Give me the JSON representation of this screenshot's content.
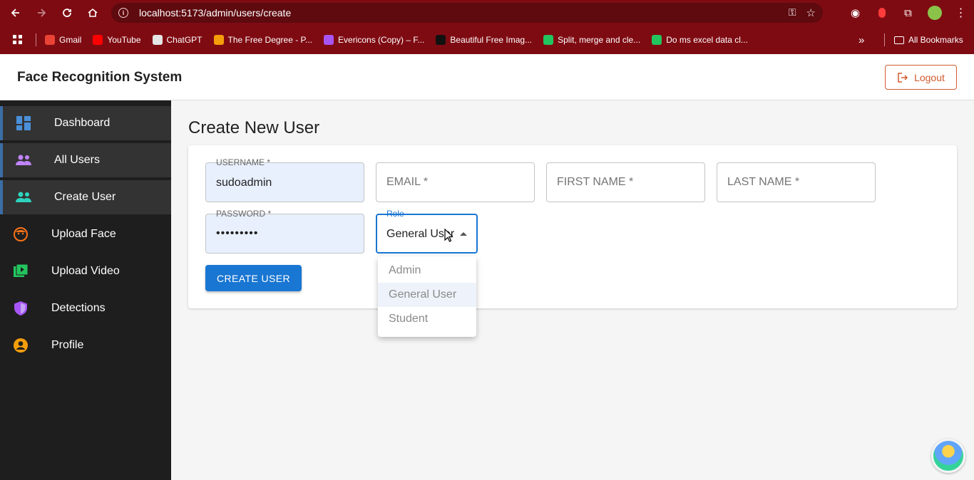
{
  "browser": {
    "url": "localhost:5173/admin/users/create",
    "bookmarks": [
      {
        "label": "Gmail",
        "color": "#ea4335"
      },
      {
        "label": "YouTube",
        "color": "#ff0000"
      },
      {
        "label": "ChatGPT",
        "color": "#e5e5e5"
      },
      {
        "label": "The Free Degree - P...",
        "color": "#f59e0b"
      },
      {
        "label": "Evericons (Copy) – F...",
        "color": "#a855f7"
      },
      {
        "label": "Beautiful Free Imag...",
        "color": "#111111"
      },
      {
        "label": "Split, merge and cle...",
        "color": "#22c55e"
      },
      {
        "label": "Do ms excel data cl...",
        "color": "#22c55e"
      }
    ],
    "all_bookmarks_label": "All Bookmarks"
  },
  "header": {
    "title": "Face Recognition System",
    "logout_label": "Logout"
  },
  "sidebar": {
    "items": [
      {
        "label": "Dashboard",
        "icon": "dashboard-icon",
        "color": "#4a90d9"
      },
      {
        "label": "All Users",
        "icon": "users-icon",
        "color": "#c084fc"
      },
      {
        "label": "Create User",
        "icon": "users-icon",
        "color": "#2dd4bf"
      },
      {
        "label": "Upload Face",
        "icon": "face-icon",
        "color": "#f97316"
      },
      {
        "label": "Upload Video",
        "icon": "video-icon",
        "color": "#22c55e"
      },
      {
        "label": "Detections",
        "icon": "shield-icon",
        "color": "#a855f7"
      },
      {
        "label": "Profile",
        "icon": "account-icon",
        "color": "#f59e0b"
      }
    ]
  },
  "main": {
    "title": "Create New User",
    "fields": {
      "username": {
        "label": "USERNAME *",
        "value": "sudoadmin"
      },
      "email": {
        "placeholder": "EMAIL *"
      },
      "first_name": {
        "placeholder": "FIRST NAME *"
      },
      "last_name": {
        "placeholder": "LAST NAME *"
      },
      "password": {
        "label": "PASSWORD *",
        "value": "•••••••••"
      },
      "role": {
        "label": "Role",
        "value": "General User"
      }
    },
    "role_options": [
      "Admin",
      "General User",
      "Student"
    ],
    "create_button": "CREATE USER"
  },
  "colors": {
    "chrome": "#7f0b12",
    "primary": "#1976d2",
    "logout": "#d25a2f",
    "sidebar_bg": "#1e1e1e"
  }
}
